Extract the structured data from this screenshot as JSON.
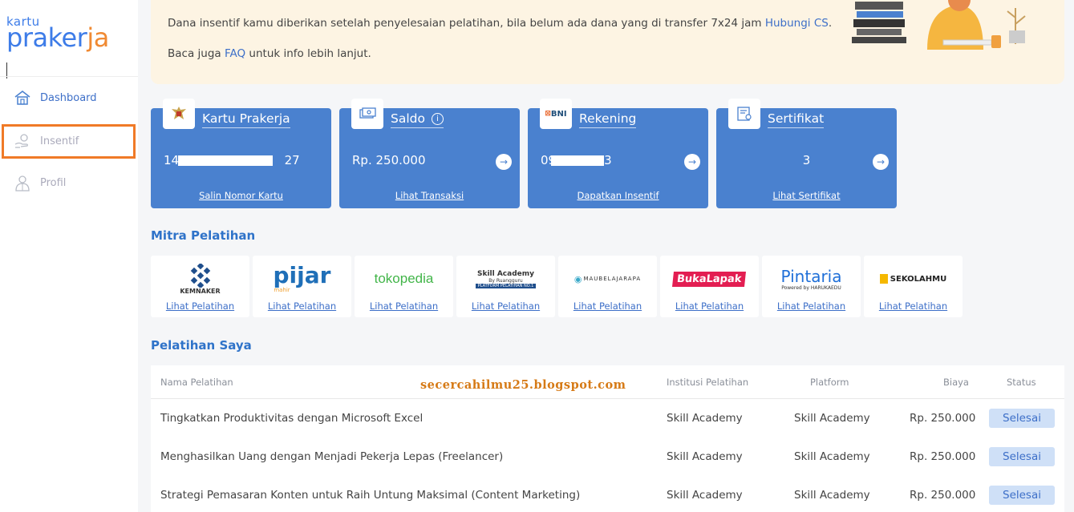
{
  "logo": {
    "small": "kartu",
    "big_a": "prake",
    "big_b": "r",
    "big_c": "ja"
  },
  "sidebar": {
    "items": [
      {
        "label": "Dashboard",
        "icon": "home-icon"
      },
      {
        "label": "Insentif",
        "icon": "hand-coin-icon"
      },
      {
        "label": "Profil",
        "icon": "person-icon"
      }
    ]
  },
  "banner": {
    "line1_text": "Dana insentif kamu diberikan setelah penyelesaian pelatihan, bila belum ada dana yang di transfer 7x24 jam ",
    "line1_link": "Hubungi CS",
    "line1_suffix": ".",
    "line2_prefix": "Baca juga ",
    "line2_link": "FAQ",
    "line2_suffix": " untuk info lebih lanjut."
  },
  "cards": [
    {
      "title": "Kartu Prakerja",
      "value_prefix": "140",
      "value_suffix": "27",
      "link": "Salin Nomor Kartu",
      "icon": "garuda-emblem-icon"
    },
    {
      "title": "Saldo",
      "info": "i",
      "value": "Rp. 250.000",
      "link": "Lihat Transaksi",
      "icon": "money-icon"
    },
    {
      "title": "Rekening",
      "bank": "BNI",
      "value_prefix": "09",
      "value_suffix": "3",
      "link": "Dapatkan Insentif",
      "icon": "bni-logo-icon"
    },
    {
      "title": "Sertifikat",
      "value": "3",
      "link": "Lihat Sertifikat",
      "icon": "certificate-icon"
    }
  ],
  "arrow_glyph": "→",
  "mitra": {
    "title": "Mitra Pelatihan",
    "partners": [
      {
        "name": "KEMNAKER",
        "link": "Lihat Pelatihan"
      },
      {
        "name": "pijar",
        "sub": "mahir",
        "link": "Lihat Pelatihan"
      },
      {
        "name": "tokopedia",
        "link": "Lihat Pelatihan"
      },
      {
        "name": "Skill Academy",
        "sub": "By Ruangguru",
        "tag": "PLATFORM PELATIHAN NO.1",
        "link": "Lihat Pelatihan"
      },
      {
        "name": "MAUBELAJARAPA",
        "link": "Lihat Pelatihan"
      },
      {
        "name": "BukaLapak",
        "link": "Lihat Pelatihan"
      },
      {
        "name": "Pintaria",
        "sub": "Powered by HARUKAEDU",
        "link": "Lihat Pelatihan"
      },
      {
        "name": "SEKOLAHMU",
        "link": "Lihat Pelatihan"
      }
    ]
  },
  "pelatihan": {
    "title": "Pelatihan Saya",
    "watermark": "secercahilmu25.blogspot.com",
    "headers": [
      "Nama Pelatihan",
      "Institusi Pelatihan",
      "Platform",
      "Biaya",
      "Status"
    ],
    "rows": [
      {
        "nama": "Tingkatkan Produktivitas dengan Microsoft Excel",
        "institusi": "Skill Academy",
        "platform": "Skill Academy",
        "biaya": "Rp. 250.000",
        "status": "Selesai"
      },
      {
        "nama": "Menghasilkan Uang dengan Menjadi Pekerja Lepas (Freelancer)",
        "institusi": "Skill Academy",
        "platform": "Skill Academy",
        "biaya": "Rp. 250.000",
        "status": "Selesai"
      },
      {
        "nama": "Strategi Pemasaran Konten untuk Raih Untung Maksimal (Content Marketing)",
        "institusi": "Skill Academy",
        "platform": "Skill Academy",
        "biaya": "Rp. 250.000",
        "status": "Selesai"
      }
    ]
  },
  "colors": {
    "primary": "#4a81cf",
    "accent": "#f08a33",
    "highlight": "#f07a27",
    "banner_bg": "#fdf4e3"
  }
}
